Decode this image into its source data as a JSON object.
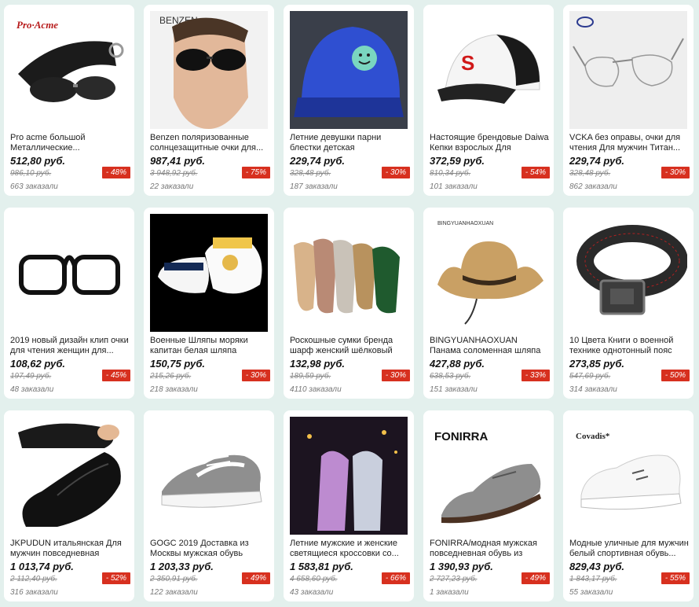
{
  "products": [
    {
      "title": "Pro acme большой Металлические...",
      "price": "512,80 руб.",
      "old_price": "986,10 руб.",
      "discount": "- 48%",
      "orders": "663 заказали",
      "brand": "Pro·Acme",
      "image": "sunglasses-case-icon"
    },
    {
      "title": "Benzen поляризованные солнцезащитные очки для...",
      "price": "987,41 руб.",
      "old_price": "3 948,92 руб.",
      "discount": "- 75%",
      "orders": "22 заказали",
      "brand": "BENZEN",
      "image": "man-sunglasses-icon"
    },
    {
      "title": "Летние девушки парни блестки детская бейсбольная Кепка...",
      "price": "229,74 руб.",
      "old_price": "328,48 руб.",
      "discount": "- 30%",
      "orders": "187 заказали",
      "brand": "",
      "image": "sequin-cap-icon"
    },
    {
      "title": "Настоящие брендовые Daiwa Кепки взрослых Для мужчин...",
      "price": "372,59 руб.",
      "old_price": "810,34 руб.",
      "discount": "- 54%",
      "orders": "101 заказали",
      "brand": "",
      "image": "racing-cap-icon"
    },
    {
      "title": "VCKA без оправы, очки для чтения Для мужчин Титан...",
      "price": "229,74 руб.",
      "old_price": "328,48 руб.",
      "discount": "- 30%",
      "orders": "862 заказали",
      "brand": "",
      "image": "rimless-glasses-icon"
    },
    {
      "title": "2019 новый дизайн клип очки для чтения женщин для...",
      "price": "108,62 руб.",
      "old_price": "197,49 руб.",
      "discount": "- 45%",
      "orders": "48 заказали",
      "brand": "",
      "image": "clip-glasses-icon"
    },
    {
      "title": "Военные Шляпы моряки капитан белая шляпа темно-...",
      "price": "150,75 руб.",
      "old_price": "215,26 руб.",
      "discount": "- 30%",
      "orders": "218 заказали",
      "brand": "",
      "image": "sailor-hat-icon"
    },
    {
      "title": "Роскошные сумки бренда шарф женский шёлковый шарф,...",
      "price": "132,98 руб.",
      "old_price": "189,59 руб.",
      "discount": "- 30%",
      "orders": "4110 заказали",
      "brand": "",
      "image": "silk-scarves-icon"
    },
    {
      "title": "BINGYUANHAOXUAN Панама соломенная шляпа летняя...",
      "price": "427,88 руб.",
      "old_price": "638,53 руб.",
      "discount": "- 33%",
      "orders": "151 заказали",
      "brand": "BINGYUANHAOXUAN",
      "image": "straw-hat-icon"
    },
    {
      "title": "10 Цвета Книги о военной технике однотонный пояс Дл...",
      "price": "273,85 руб.",
      "old_price": "547,69 руб.",
      "discount": "- 50%",
      "orders": "314 заказали",
      "brand": "",
      "image": "tactical-belt-icon"
    },
    {
      "title": "JKPUDUN итальянская Для мужчин повседневная обувь...",
      "price": "1 013,74 руб.",
      "old_price": "2 112,40 руб.",
      "discount": "- 52%",
      "orders": "316 заказали",
      "brand": "",
      "image": "loafer-icon"
    },
    {
      "title": "GOGC 2019 Доставка из Москвы мужская обувь сникерсы...",
      "price": "1 203,33 руб.",
      "old_price": "2 350,91 руб.",
      "discount": "- 49%",
      "orders": "122 заказали",
      "brand": "",
      "image": "canvas-sneaker-icon"
    },
    {
      "title": "Летние мужские и женские светящиеся кроссовки со...",
      "price": "1 583,81 руб.",
      "old_price": "4 658,60 руб.",
      "discount": "- 66%",
      "orders": "43 заказали",
      "brand": "",
      "image": "led-sneakers-icon"
    },
    {
      "title": "FONIRRA/модная мужская повседневная обувь из замш...",
      "price": "1 390,93 руб.",
      "old_price": "2 727,23 руб.",
      "discount": "- 49%",
      "orders": "1 заказали",
      "brand": "FONIRRA",
      "image": "suede-shoe-icon"
    },
    {
      "title": "Модные уличные для мужчин белый спортивная обувь...",
      "price": "829,43 руб.",
      "old_price": "1 843,17 руб.",
      "discount": "- 55%",
      "orders": "55 заказали",
      "brand": "Covadis*",
      "image": "white-sneaker-icon"
    }
  ]
}
